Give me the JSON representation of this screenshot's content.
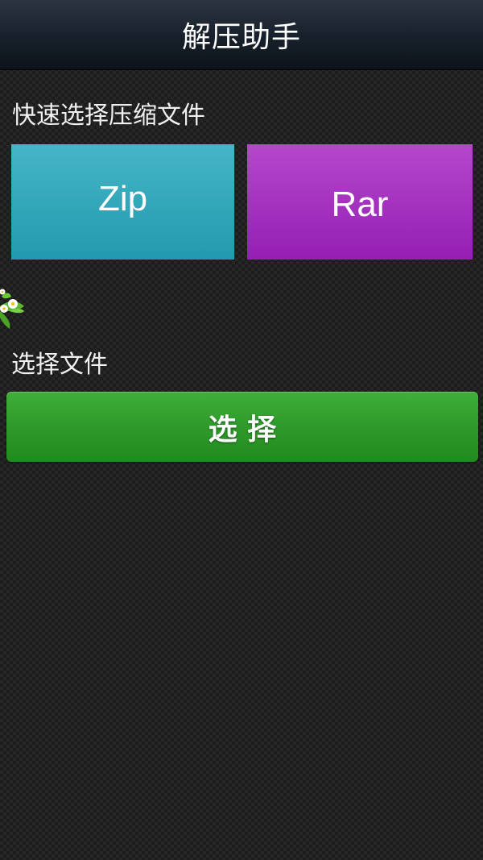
{
  "header": {
    "title": "解压助手"
  },
  "quick_select": {
    "label": "快速选择压缩文件",
    "zip_label": "Zip",
    "rar_label": "Rar"
  },
  "file_select": {
    "label": "选择文件",
    "button_label": "选 择"
  },
  "colors": {
    "zip_tile": "#2ea6b9",
    "rar_tile": "#a633c0",
    "select_button": "#2f9a2a"
  },
  "icons": {
    "decoration": "flower-icon"
  }
}
